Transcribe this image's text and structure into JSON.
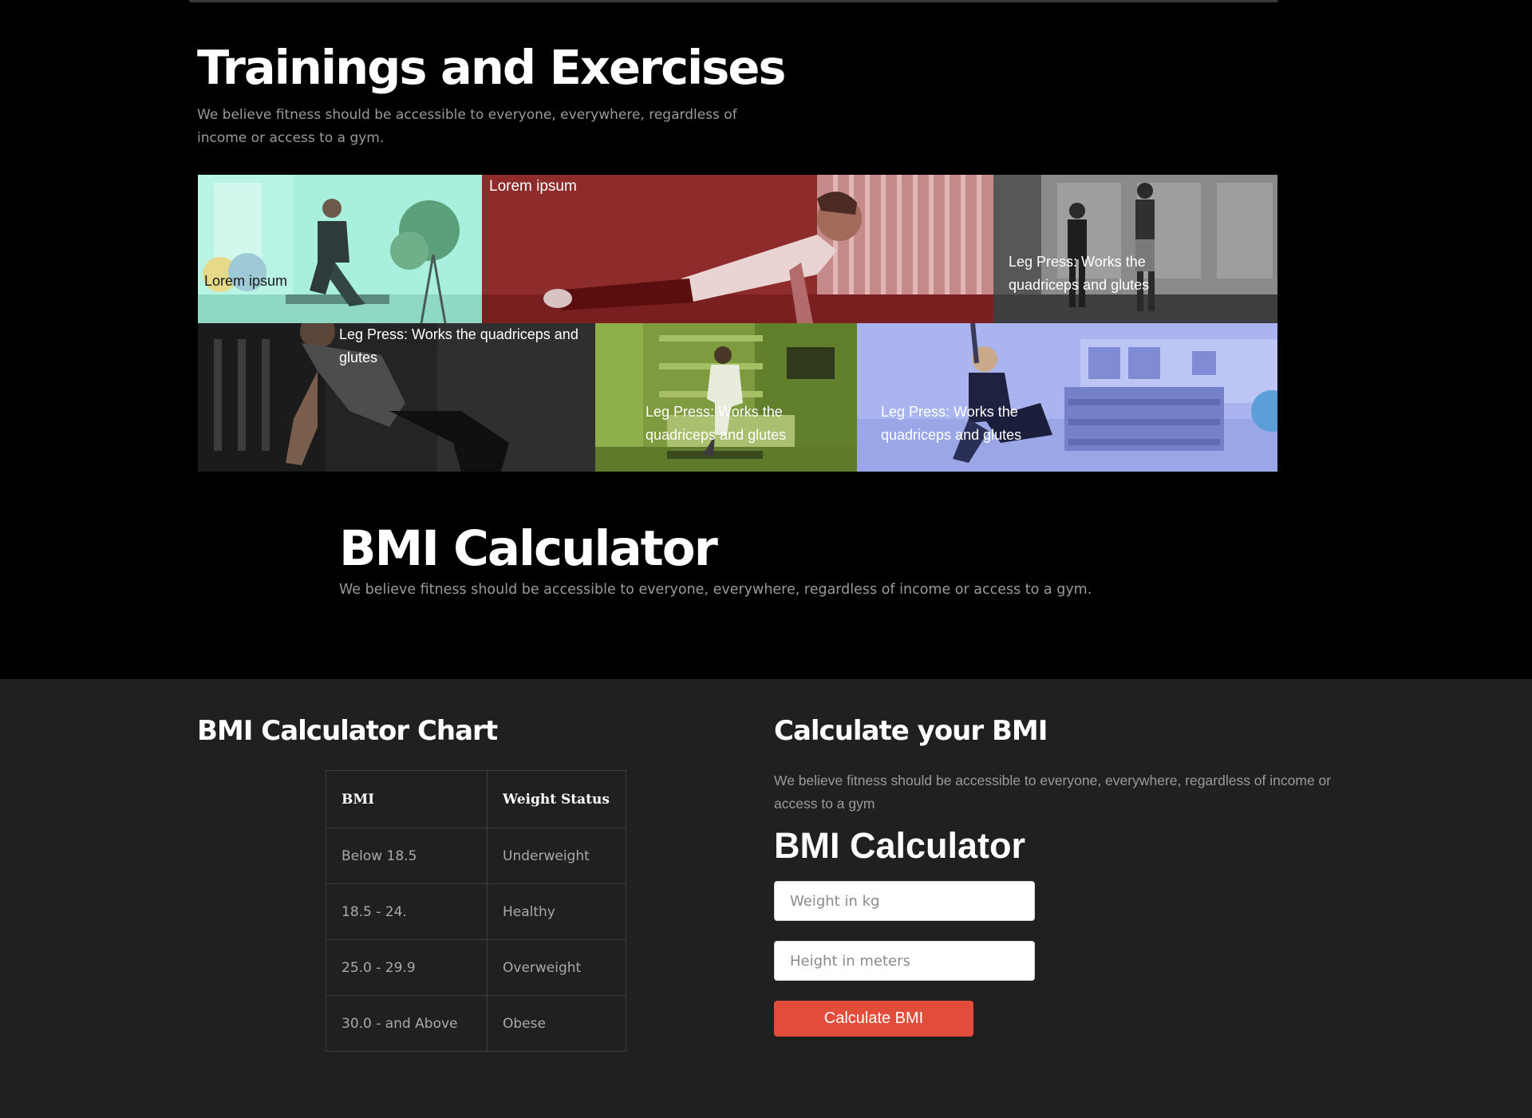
{
  "trainings": {
    "title": "Trainings and Exercises",
    "subtitle": "We believe fitness should be accessible to everyone, everywhere, regardless of income or access to a gym."
  },
  "tiles": [
    {
      "caption": "Lorem ipsum",
      "color": "#a6efdc"
    },
    {
      "caption": "Lorem ipsum",
      "color": "#8c2626"
    },
    {
      "caption": "Leg Press: Works the quadriceps and glutes",
      "color": "#4a4a4a"
    },
    {
      "caption": "Leg Press: Works the quadriceps and glutes",
      "color": "#2a2a2a"
    },
    {
      "caption": "Leg Press: Works the quadriceps and glutes",
      "color": "#7a9a3a"
    },
    {
      "caption": "Leg Press: Works the quadriceps and glutes",
      "color": "#a9b4ef"
    }
  ],
  "bmi_hero": {
    "title": "BMI Calculator",
    "subtitle": "We believe fitness should be accessible to everyone, everywhere, regardless of income or access to a gym."
  },
  "chart": {
    "title": "BMI Calculator Chart",
    "headers": [
      "BMI",
      "Weight Status"
    ],
    "rows": [
      [
        "Below 18.5",
        "Underweight"
      ],
      [
        "18.5 - 24.",
        "Healthy"
      ],
      [
        "25.0 - 29.9",
        "Overweight"
      ],
      [
        "30.0 - and Above",
        "Obese"
      ]
    ]
  },
  "calculator": {
    "title": "Calculate your BMI",
    "subtitle": "We believe fitness should be accessible to everyone, everywhere, regardless of income or access to a gym",
    "form_title": "BMI Calculator",
    "weight_placeholder": "Weight in kg",
    "weight_value": "",
    "height_placeholder": "Height in meters",
    "height_value": "",
    "button_label": "Calculate BMI",
    "button_color": "#e24c3b"
  }
}
